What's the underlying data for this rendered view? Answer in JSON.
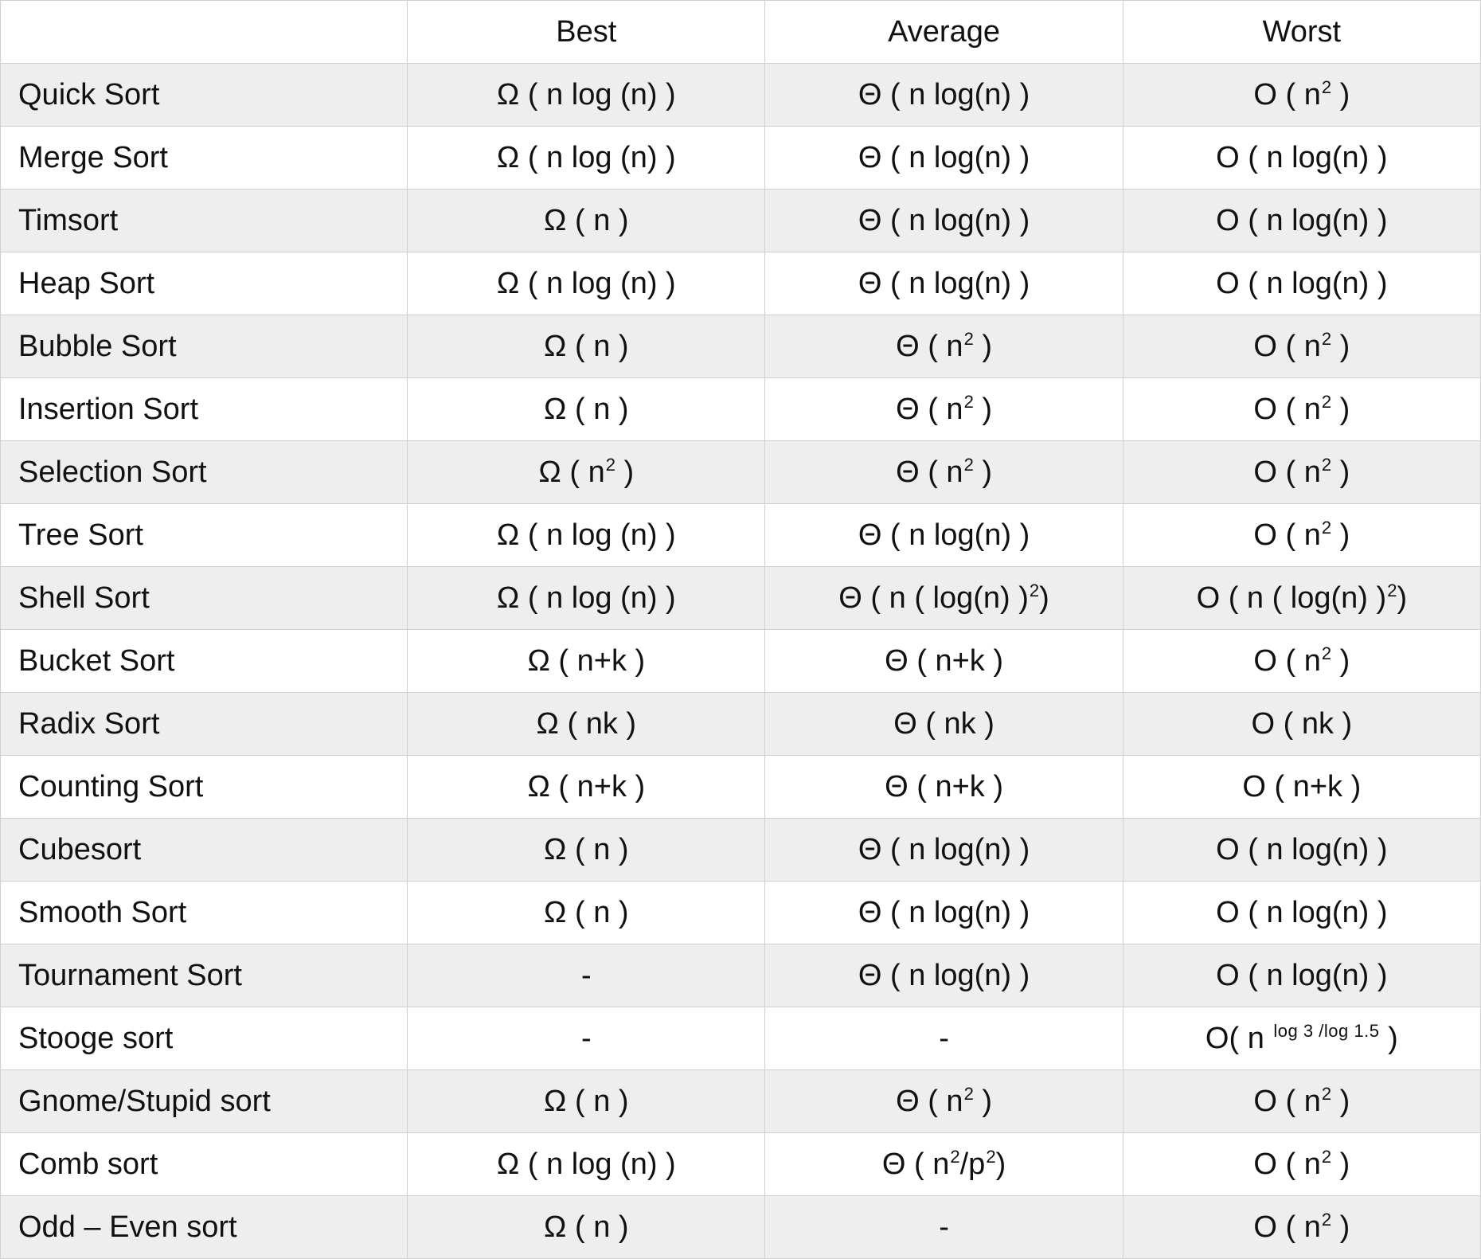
{
  "chart_data": {
    "type": "table",
    "title": "Sorting algorithm time complexity",
    "columns": [
      "",
      "Best",
      "Average",
      "Worst"
    ],
    "rows": [
      {
        "name": "Quick Sort",
        "best": "Ω ( n log (n) )",
        "average": "Θ ( n log(n) )",
        "worst": "O ( n² )"
      },
      {
        "name": "Merge Sort",
        "best": "Ω ( n log (n) )",
        "average": "Θ ( n log(n) )",
        "worst": "O ( n log(n) )"
      },
      {
        "name": "Timsort",
        "best": "Ω ( n )",
        "average": "Θ ( n log(n) )",
        "worst": "O ( n log(n) )"
      },
      {
        "name": "Heap Sort",
        "best": "Ω ( n log (n) )",
        "average": "Θ ( n log(n) )",
        "worst": "O ( n log(n) )"
      },
      {
        "name": "Bubble Sort",
        "best": "Ω ( n )",
        "average": "Θ ( n² )",
        "worst": "O ( n² )"
      },
      {
        "name": "Insertion Sort",
        "best": "Ω ( n )",
        "average": "Θ ( n² )",
        "worst": "O ( n² )"
      },
      {
        "name": "Selection Sort",
        "best": "Ω ( n² )",
        "average": "Θ ( n² )",
        "worst": "O ( n² )"
      },
      {
        "name": "Tree Sort",
        "best": "Ω ( n log (n) )",
        "average": "Θ ( n log(n) )",
        "worst": "O ( n² )"
      },
      {
        "name": "Shell Sort",
        "best": "Ω ( n log (n) )",
        "average": "Θ ( n ( log(n) )²)",
        "worst": "O ( n ( log(n) )²)"
      },
      {
        "name": "Bucket Sort",
        "best": "Ω ( n+k )",
        "average": "Θ ( n+k )",
        "worst": "O ( n² )"
      },
      {
        "name": "Radix Sort",
        "best": "Ω ( nk )",
        "average": "Θ ( nk )",
        "worst": "O ( nk )"
      },
      {
        "name": "Counting Sort",
        "best": "Ω ( n+k )",
        "average": "Θ ( n+k )",
        "worst": "O ( n+k )"
      },
      {
        "name": "Cubesort",
        "best": "Ω ( n )",
        "average": "Θ ( n log(n) )",
        "worst": "O ( n log(n) )"
      },
      {
        "name": "Smooth Sort",
        "best": "Ω ( n )",
        "average": "Θ ( n log(n) )",
        "worst": "O ( n log(n) )"
      },
      {
        "name": "Tournament Sort",
        "best": "-",
        "average": "Θ ( n log(n) )",
        "worst": "O ( n log(n) )"
      },
      {
        "name": "Stooge sort",
        "best": "-",
        "average": "-",
        "worst": "O( n ^(log 3 /log 1.5) )"
      },
      {
        "name": "Gnome/Stupid sort",
        "best": "Ω ( n )",
        "average": "Θ ( n² )",
        "worst": "O ( n² )"
      },
      {
        "name": "Comb sort",
        "best": "Ω ( n log (n) )",
        "average": "Θ ( n²/p²)",
        "worst": "O ( n² )"
      },
      {
        "name": "Odd – Even sort",
        "best": "Ω ( n )",
        "average": "-",
        "worst": "O ( n² )"
      }
    ]
  },
  "headers": {
    "name": "",
    "best": "Best",
    "average": "Average",
    "worst": "Worst"
  }
}
